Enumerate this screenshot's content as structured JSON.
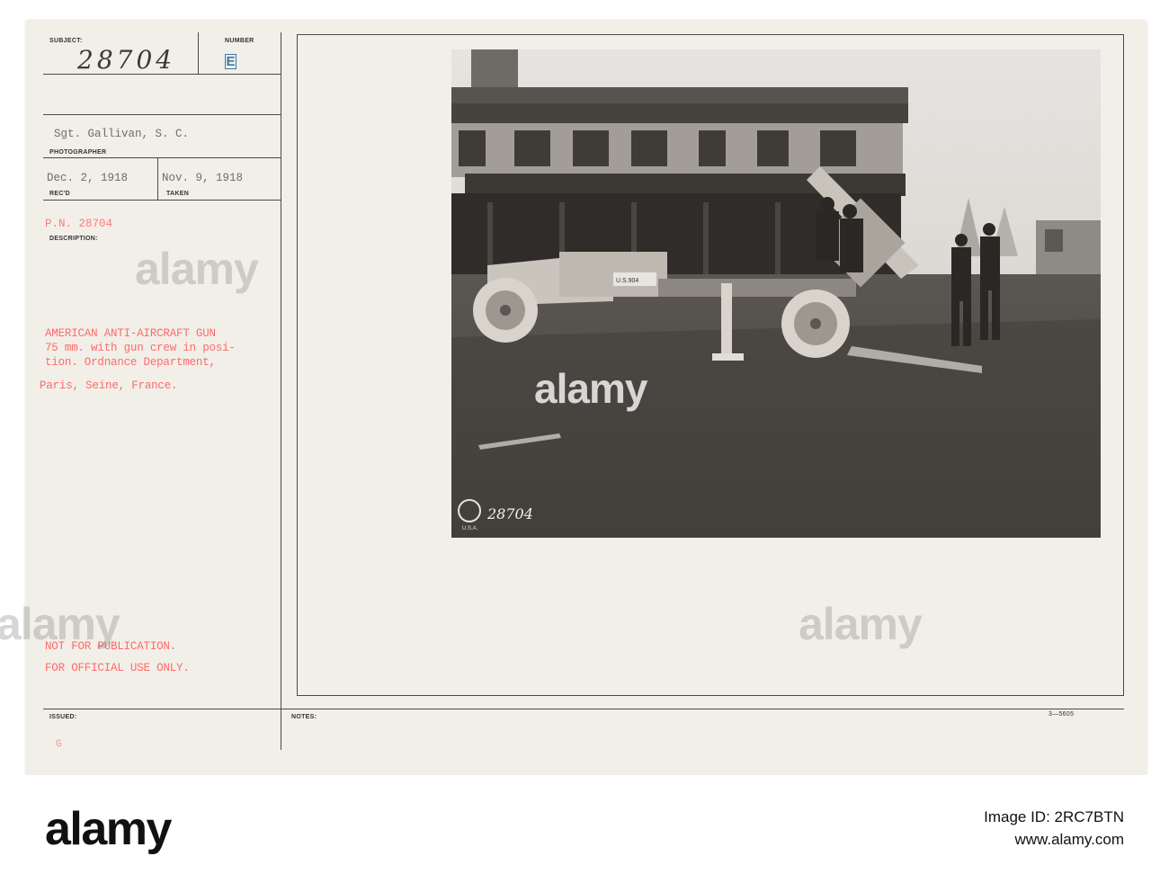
{
  "card": {
    "subject_label": "SUBJECT:",
    "subject_handwritten": "28704",
    "number_label": "NUMBER",
    "number_stamp": "E",
    "photographer_value": "Sgt. Gallivan, S. C.",
    "photographer_label": "PHOTOGRAPHER",
    "recd_value": "Dec. 2, 1918",
    "recd_label": "REC'D",
    "taken_value": "Nov. 9, 1918",
    "taken_label": "TAKEN",
    "pn_value": "P.N. 28704",
    "description_label": "DESCRIPTION:",
    "description_lines": [
      "AMERICAN ANTI-AIRCRAFT GUN",
      "75 mm. with gun crew in posi-",
      "tion. Ordnance Department,",
      "Paris, Seine, France."
    ],
    "restriction_lines": [
      "NOT FOR PUBLICATION.",
      "FOR OFFICIAL USE ONLY."
    ],
    "issued_label": "ISSUED:",
    "issued_value": "G",
    "notes_label": "NOTES:",
    "form_number": "3—5605"
  },
  "photo": {
    "vehicle_plate": "U.S.904",
    "negative_number": "28704",
    "stamp_text": "U.S.A."
  },
  "watermark": {
    "brand": "alamy"
  },
  "footer": {
    "brand": "alamy",
    "image_id_label": "Image ID: 2RC7BTN",
    "site": "www.alamy.com"
  },
  "colors": {
    "card": "#f1efe8",
    "red_type": "#ff6a6a",
    "blue_stamp": "#3d78a8"
  }
}
